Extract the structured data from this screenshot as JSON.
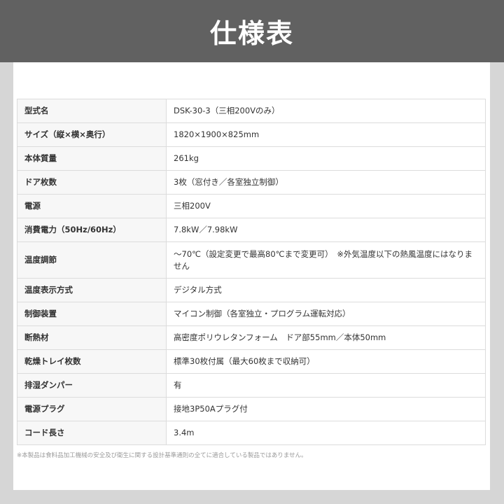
{
  "header": {
    "title": "仕様表"
  },
  "spec_table": {
    "rows": [
      {
        "label": "型式名",
        "value": "DSK-30-3（三相200Vのみ）"
      },
      {
        "label": "サイズ（縦×横×奥行）",
        "value": "1820×1900×825mm"
      },
      {
        "label": "本体質量",
        "value": "261kg"
      },
      {
        "label": "ドア枚数",
        "value": "3枚（窓付き／各室独立制御）"
      },
      {
        "label": "電源",
        "value": "三相200V"
      },
      {
        "label": "消費電力（50Hz/60Hz）",
        "value": "7.8kW／7.98kW"
      },
      {
        "label": "温度調節",
        "value": "～70℃（設定変更で最高80℃まで変更可）　※外気温度以下の熱風温度にはなりません"
      },
      {
        "label": "温度表示方式",
        "value": "デジタル方式"
      },
      {
        "label": "制御装置",
        "value": "マイコン制御（各室独立・プログラム運転対応）"
      },
      {
        "label": "断熱材",
        "value": "高密度ポリウレタンフォーム　ドア部55mm／本体50mm"
      },
      {
        "label": "乾燥トレイ枚数",
        "value": "標準30枚付属（最大60枚まで収納可）"
      },
      {
        "label": "排湿ダンパー",
        "value": "有"
      },
      {
        "label": "電源プラグ",
        "value": "接地3P50Aプラグ付"
      },
      {
        "label": "コード長さ",
        "value": "3.4m"
      }
    ]
  },
  "footnote": "※本製品は食料品加工機械の安全及び衛生に関する設計基準通則の全てに適合している製品ではありません。"
}
